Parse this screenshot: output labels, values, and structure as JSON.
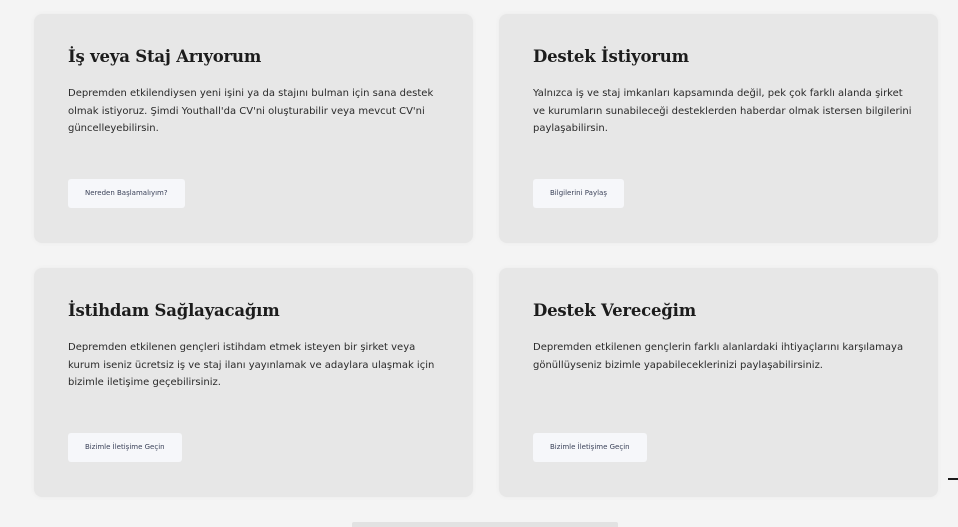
{
  "cards": [
    {
      "title": "İş veya Staj Arıyorum",
      "body": "Depremden etkilendiysen yeni işini ya da stajını bulman için sana destek olmak istiyoruz. Şimdi Youthall'da CV'ni oluşturabilir veya mevcut CV'ni güncelleyebilirsin.",
      "button": "Nereden Başlamalıyım?"
    },
    {
      "title": "Destek İstiyorum",
      "body": "Yalnızca iş ve staj imkanları kapsamında değil, pek çok farklı alanda şirket ve kurumların sunabileceği desteklerden haberdar olmak istersen bilgilerini paylaşabilirsin.",
      "button": "Bilgilerini Paylaş"
    },
    {
      "title": "İstihdam Sağlayacağım",
      "body": "Depremden etkilenen gençleri istihdam etmek isteyen bir şirket veya kurum iseniz ücretsiz iş ve staj ilanı yayınlamak ve adaylara ulaşmak için bizimle iletişime geçebilirsiniz.",
      "button": "Bizimle İletişime Geçin"
    },
    {
      "title": "Destek Vereceğim",
      "body": "Depremden etkilenen gençlerin farklı alanlardaki ihtiyaçlarını karşılamaya gönüllüyseniz bizimle yapabileceklerinizi paylaşabilirsiniz.",
      "button": "Bizimle İletişime Geçin"
    }
  ],
  "colors": {
    "page_background": "#f4f4f4",
    "card_background": "#e7e7e7",
    "button_background": "#f6f7fa",
    "button_text": "#3b4259",
    "title_text": "#1c1c1c"
  }
}
